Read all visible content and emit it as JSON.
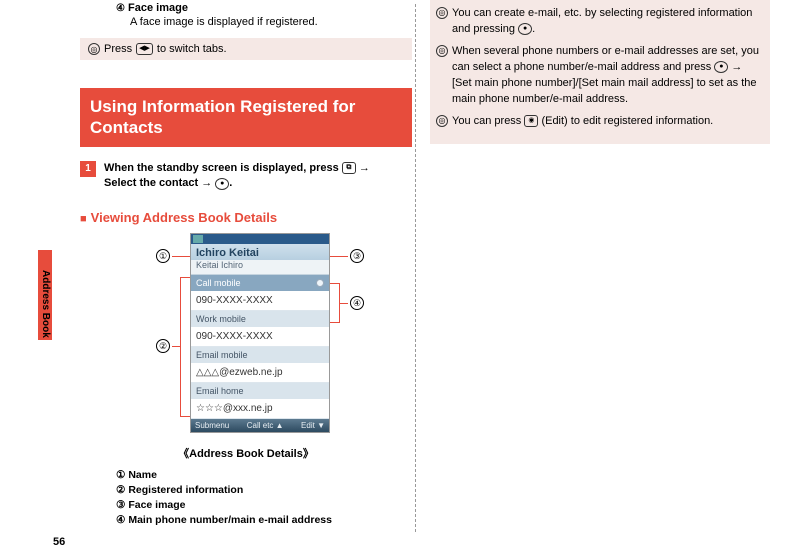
{
  "sideTab": "Address Book",
  "pageNumber": "56",
  "faceImage": {
    "marker": "④",
    "title": "Face image",
    "desc": "A face image is displayed if registered."
  },
  "tip": {
    "prefix": "Press",
    "suffix": "to switch tabs."
  },
  "sectionHeader": "Using Information Registered for Contacts",
  "step1": {
    "num": "1",
    "partA": "When the standby screen is displayed, press",
    "partB": "Select the contact"
  },
  "subhead": "Viewing Address Book Details",
  "phone": {
    "name": "Ichiro Keitai",
    "sub": "Keitai Ichiro",
    "rows": [
      {
        "label": "Call mobile",
        "value": "090-XXXX-XXXX"
      },
      {
        "label": "Work mobile",
        "value": "090-XXXX-XXXX"
      },
      {
        "label": "Email mobile",
        "value": "△△△@ezweb.ne.jp"
      },
      {
        "label": "Email home",
        "value": "☆☆☆@xxx.ne.jp"
      }
    ],
    "soft": {
      "left": "Submenu",
      "center": "Call etc",
      "right": "Edit"
    }
  },
  "callouts": {
    "c1": "①",
    "c2": "②",
    "c3": "③",
    "c4": "④"
  },
  "caption": "《Address Book Details》",
  "legend": {
    "l1": "① Name",
    "l2": "② Registered information",
    "l3": "③ Face image",
    "l4": "④ Main phone number/main e-mail address"
  },
  "notes": {
    "n1a": "You can create e-mail, etc. by selecting registered information and pressing",
    "n1b": ".",
    "n2a": "When several phone numbers or e-mail addresses are set, you can select a phone number/e-mail address and press",
    "n2b": "[Set main phone number]/[Set main mail address] to set as the main phone number/e-mail address.",
    "n3a": "You can press",
    "n3b": "(Edit) to edit registered information."
  }
}
